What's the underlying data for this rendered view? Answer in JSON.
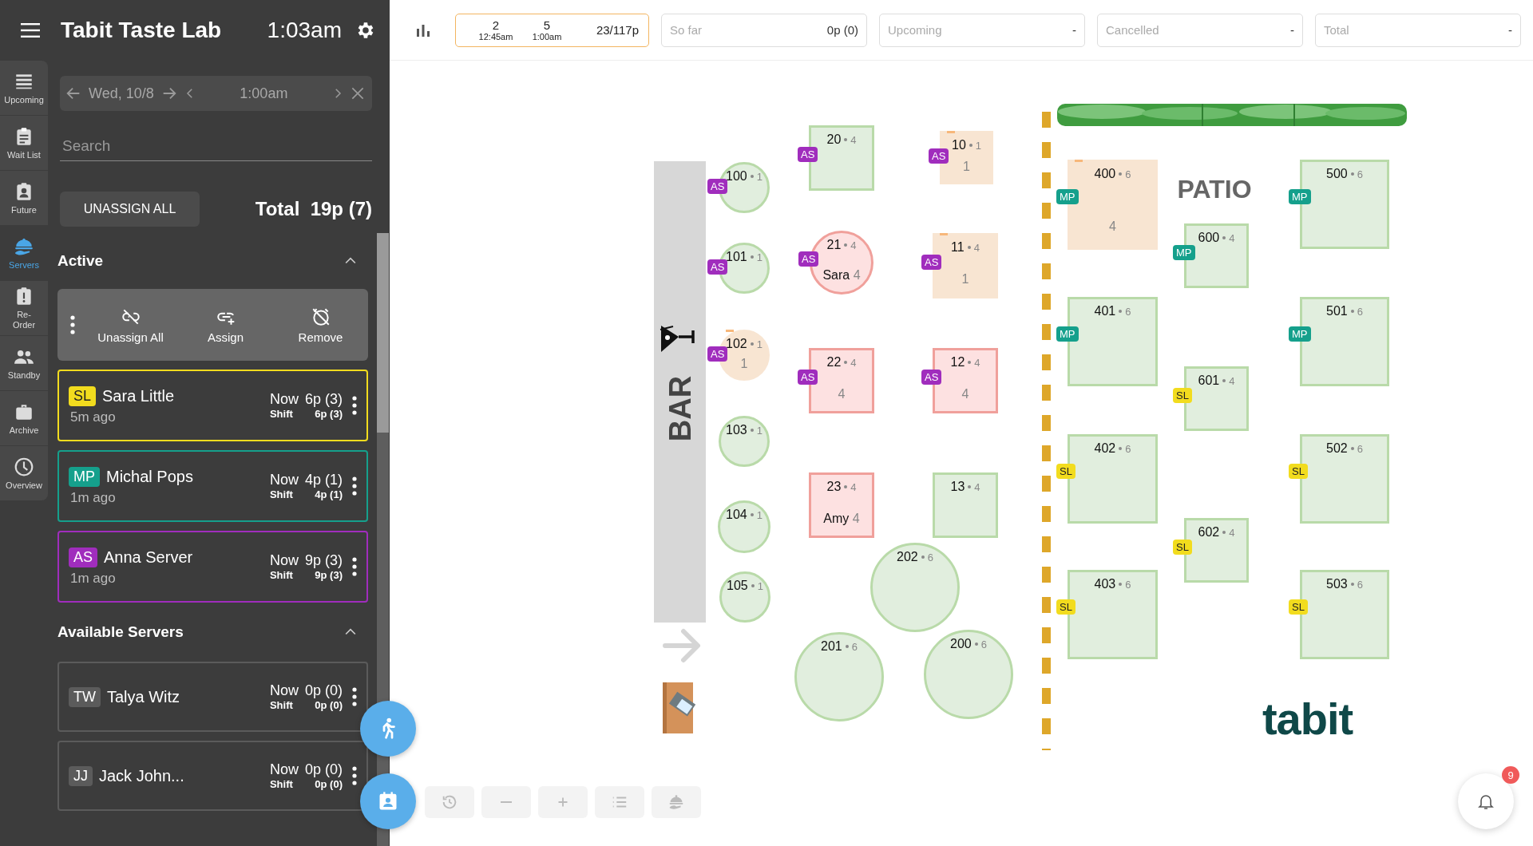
{
  "header": {
    "title": "Tabit Taste Lab",
    "time": "1:03am"
  },
  "nav": [
    {
      "label": "Upcoming",
      "kind": "list",
      "selected": false
    },
    {
      "label": "Wait List",
      "kind": "clipboard",
      "selected": false
    },
    {
      "label": "Future",
      "kind": "badge",
      "selected": false
    },
    {
      "label": "Servers",
      "kind": "server",
      "selected": true
    },
    {
      "label": "Re-\nOrder",
      "kind": "alert",
      "selected": false
    },
    {
      "label": "Standby",
      "kind": "people",
      "selected": false
    },
    {
      "label": "Archive",
      "kind": "briefcase",
      "selected": false
    },
    {
      "label": "Overview",
      "kind": "clock",
      "selected": false
    }
  ],
  "date_nav": {
    "date": "Wed, 10/8",
    "time": "1:00am"
  },
  "search": {
    "placeholder": "Search"
  },
  "unassign_button": "UNASSIGN ALL",
  "total": {
    "label": "Total",
    "value": "19p (7)"
  },
  "active": {
    "title": "Active",
    "expanded": true,
    "actions": [
      {
        "label": "Unassign All",
        "kind": "unlink"
      },
      {
        "label": "Assign",
        "kind": "link"
      },
      {
        "label": "Remove",
        "kind": "alarm-off"
      }
    ],
    "servers": [
      {
        "initials": "SL",
        "name": "Sara Little",
        "ago": "5m ago",
        "now_label": "Now",
        "now": "6p (3)",
        "shift_label": "Shift",
        "shift": "6p (3)",
        "color": "#f2dc1e"
      },
      {
        "initials": "MP",
        "name": "Michal Pops",
        "ago": "1m ago",
        "now_label": "Now",
        "now": "4p (1)",
        "shift_label": "Shift",
        "shift": "4p (1)",
        "color": "#15a08c"
      },
      {
        "initials": "AS",
        "name": "Anna Server",
        "ago": "1m ago",
        "now_label": "Now",
        "now": "9p (3)",
        "shift_label": "Shift",
        "shift": "9p (3)",
        "color": "#a02dbd"
      }
    ]
  },
  "available": {
    "title": "Available Servers",
    "expanded": true,
    "servers": [
      {
        "initials": "TW",
        "name": "Talya Witz",
        "now_label": "Now",
        "now": "0p (0)",
        "shift_label": "Shift",
        "shift": "0p (0)",
        "color": "#5b5b5b"
      },
      {
        "initials": "JJ",
        "name": "Jack John...",
        "now_label": "Now",
        "now": "0p (0)",
        "shift_label": "Shift",
        "shift": "0p (0)",
        "color": "#5b5b5b"
      }
    ]
  },
  "stats": {
    "slots": [
      {
        "count": "2",
        "time": "12:45am"
      },
      {
        "count": "5",
        "time": "1:00am"
      }
    ],
    "covers": "23/117p",
    "boxes": [
      {
        "label": "So far",
        "value": "0p (0)"
      },
      {
        "label": "Upcoming",
        "value": "-"
      },
      {
        "label": "Cancelled",
        "value": "-"
      },
      {
        "label": "Total",
        "value": "-"
      }
    ]
  },
  "floor": {
    "bar_label": "BAR",
    "patio_label": "PATIO",
    "logo": "tabit",
    "tables": [
      {
        "number": "100",
        "seats": "1",
        "kind": "round",
        "seated": false,
        "reserved": false,
        "server": {
          "initials": "AS",
          "color": "#a02dbd"
        }
      },
      {
        "number": "101",
        "seats": "1",
        "kind": "round",
        "seated": false,
        "reserved": false,
        "server": {
          "initials": "AS",
          "color": "#a02dbd"
        }
      },
      {
        "number": "102",
        "seats": "1",
        "kind": "round",
        "seated": false,
        "reserved": true,
        "covers": "1",
        "server": {
          "initials": "AS",
          "color": "#a02dbd"
        }
      },
      {
        "number": "103",
        "seats": "1",
        "kind": "round",
        "seated": false,
        "reserved": false
      },
      {
        "number": "104",
        "seats": "1",
        "kind": "round",
        "seated": false,
        "reserved": false
      },
      {
        "number": "105",
        "seats": "1",
        "kind": "round",
        "seated": false,
        "reserved": false
      },
      {
        "number": "20",
        "seats": "4",
        "kind": "square",
        "seated": false,
        "reserved": false,
        "server": {
          "initials": "AS",
          "color": "#a02dbd"
        }
      },
      {
        "number": "21",
        "seats": "4",
        "kind": "round",
        "seated": true,
        "reserved": false,
        "guest": "Sara",
        "covers": "4",
        "server": {
          "initials": "AS",
          "color": "#a02dbd"
        }
      },
      {
        "number": "22",
        "seats": "4",
        "kind": "square",
        "seated": true,
        "reserved": false,
        "covers": "4",
        "server": {
          "initials": "AS",
          "color": "#a02dbd"
        }
      },
      {
        "number": "23",
        "seats": "4",
        "kind": "square",
        "seated": true,
        "reserved": false,
        "guest": "Amy",
        "covers": "4"
      },
      {
        "number": "10",
        "seats": "1",
        "kind": "square",
        "seated": false,
        "reserved": true,
        "covers": "1",
        "server": {
          "initials": "AS",
          "color": "#a02dbd"
        }
      },
      {
        "number": "11",
        "seats": "4",
        "kind": "square",
        "seated": false,
        "reserved": true,
        "covers": "1",
        "server": {
          "initials": "AS",
          "color": "#a02dbd"
        }
      },
      {
        "number": "12",
        "seats": "4",
        "kind": "square",
        "seated": true,
        "reserved": false,
        "covers": "4",
        "server": {
          "initials": "AS",
          "color": "#a02dbd"
        }
      },
      {
        "number": "13",
        "seats": "4",
        "kind": "square",
        "seated": false,
        "reserved": false
      },
      {
        "number": "202",
        "seats": "6",
        "kind": "round",
        "seated": false,
        "reserved": false
      },
      {
        "number": "201",
        "seats": "6",
        "kind": "round",
        "seated": false,
        "reserved": false
      },
      {
        "number": "200",
        "seats": "6",
        "kind": "round",
        "seated": false,
        "reserved": false
      },
      {
        "number": "400",
        "seats": "6",
        "kind": "square",
        "seated": false,
        "reserved": true,
        "covers": "4",
        "server": {
          "initials": "MP",
          "color": "#15a08c"
        }
      },
      {
        "number": "500",
        "seats": "6",
        "kind": "square",
        "seated": false,
        "reserved": false,
        "server": {
          "initials": "MP",
          "color": "#15a08c"
        }
      },
      {
        "number": "600",
        "seats": "4",
        "kind": "square",
        "seated": false,
        "reserved": false,
        "server": {
          "initials": "MP",
          "color": "#15a08c"
        }
      },
      {
        "number": "401",
        "seats": "6",
        "kind": "square",
        "seated": false,
        "reserved": false,
        "server": {
          "initials": "MP",
          "color": "#15a08c"
        }
      },
      {
        "number": "501",
        "seats": "6",
        "kind": "square",
        "seated": false,
        "reserved": false,
        "server": {
          "initials": "MP",
          "color": "#15a08c"
        }
      },
      {
        "number": "601",
        "seats": "4",
        "kind": "square",
        "seated": false,
        "reserved": false,
        "server": {
          "initials": "SL",
          "color": "#f2dc1e"
        }
      },
      {
        "number": "402",
        "seats": "6",
        "kind": "square",
        "seated": false,
        "reserved": false,
        "server": {
          "initials": "SL",
          "color": "#f2dc1e"
        }
      },
      {
        "number": "502",
        "seats": "6",
        "kind": "square",
        "seated": false,
        "reserved": false,
        "server": {
          "initials": "SL",
          "color": "#f2dc1e"
        }
      },
      {
        "number": "602",
        "seats": "4",
        "kind": "square",
        "seated": false,
        "reserved": false,
        "server": {
          "initials": "SL",
          "color": "#f2dc1e"
        }
      },
      {
        "number": "403",
        "seats": "6",
        "kind": "square",
        "seated": false,
        "reserved": false,
        "server": {
          "initials": "SL",
          "color": "#f2dc1e"
        }
      },
      {
        "number": "503",
        "seats": "6",
        "kind": "square",
        "seated": false,
        "reserved": false,
        "server": {
          "initials": "SL",
          "color": "#f2dc1e"
        }
      }
    ]
  },
  "toolbar": [
    {
      "kind": "history"
    },
    {
      "kind": "minus"
    },
    {
      "kind": "plus"
    },
    {
      "kind": "list"
    },
    {
      "kind": "server"
    }
  ],
  "notifications": {
    "count": "9"
  }
}
